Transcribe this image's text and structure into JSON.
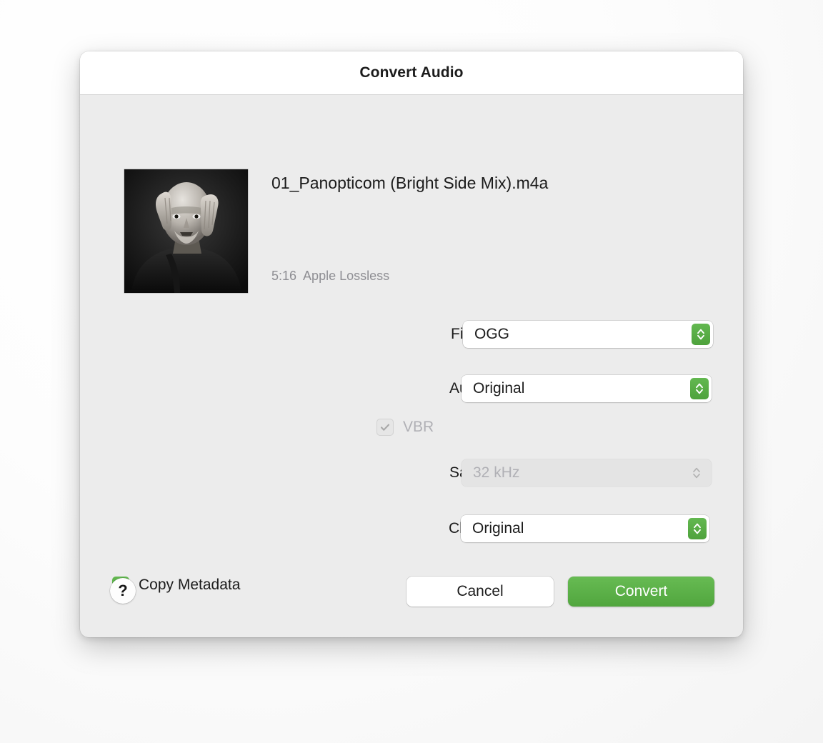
{
  "window": {
    "title": "Convert Audio"
  },
  "file": {
    "name": "01_Panopticom (Bright Side Mix).m4a",
    "duration": "5:16",
    "format": "Apple Lossless",
    "artwork_alt": "album-artwork"
  },
  "form": {
    "file_format": {
      "label": "File Format",
      "value": "OGG"
    },
    "audio_bitrate": {
      "label": "Audio Bitrate",
      "value": "Original"
    },
    "vbr": {
      "label": "VBR",
      "checked": true,
      "enabled": false
    },
    "sample_rate": {
      "label": "Sample Rate",
      "value": "32 kHz",
      "enabled": false
    },
    "channels": {
      "label": "Channels",
      "value": "Original"
    },
    "copy_metadata": {
      "label": "Copy Metadata",
      "checked": true
    }
  },
  "footer": {
    "help_label": "?",
    "cancel_label": "Cancel",
    "convert_label": "Convert"
  },
  "colors": {
    "accent_green": "#57ab44",
    "window_bg": "#ececec",
    "titlebar_bg": "#ffffff",
    "text": "#1b1b1b",
    "muted_text": "#8e8e93",
    "disabled_text": "#b0b0b5"
  }
}
